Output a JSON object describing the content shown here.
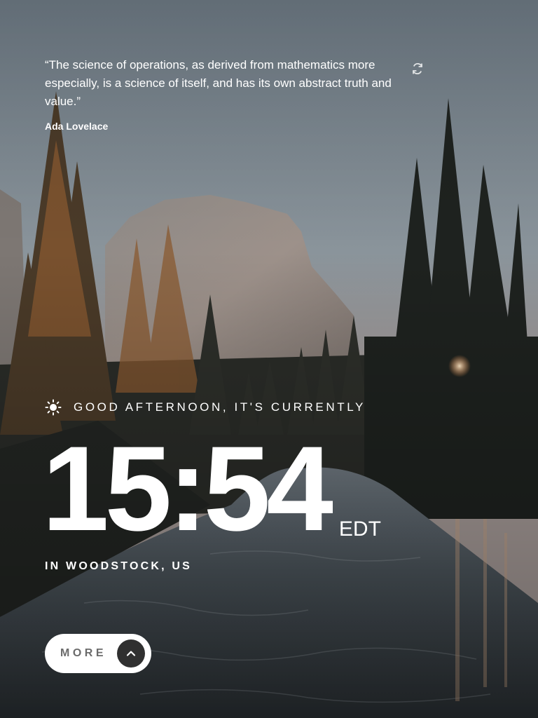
{
  "quote": {
    "text": "“The science of operations, as derived from mathematics more especially, is a science of itself, and has its own abstract truth and value.”",
    "author": "Ada Lovelace",
    "refresh_icon": "refresh-icon"
  },
  "greeting": {
    "icon": "sun-icon",
    "text": "GOOD AFTERNOON, IT'S CURRENTLY"
  },
  "clock": {
    "time": "15:54",
    "timezone": "EDT"
  },
  "location": {
    "text": "IN WOODSTOCK, US"
  },
  "more_button": {
    "label": "MORE",
    "icon": "chevron-up-icon"
  },
  "colors": {
    "text": "#ffffff",
    "button_bg": "#ffffff",
    "button_text": "#6b6b6b",
    "arrow_bg": "#303030"
  }
}
